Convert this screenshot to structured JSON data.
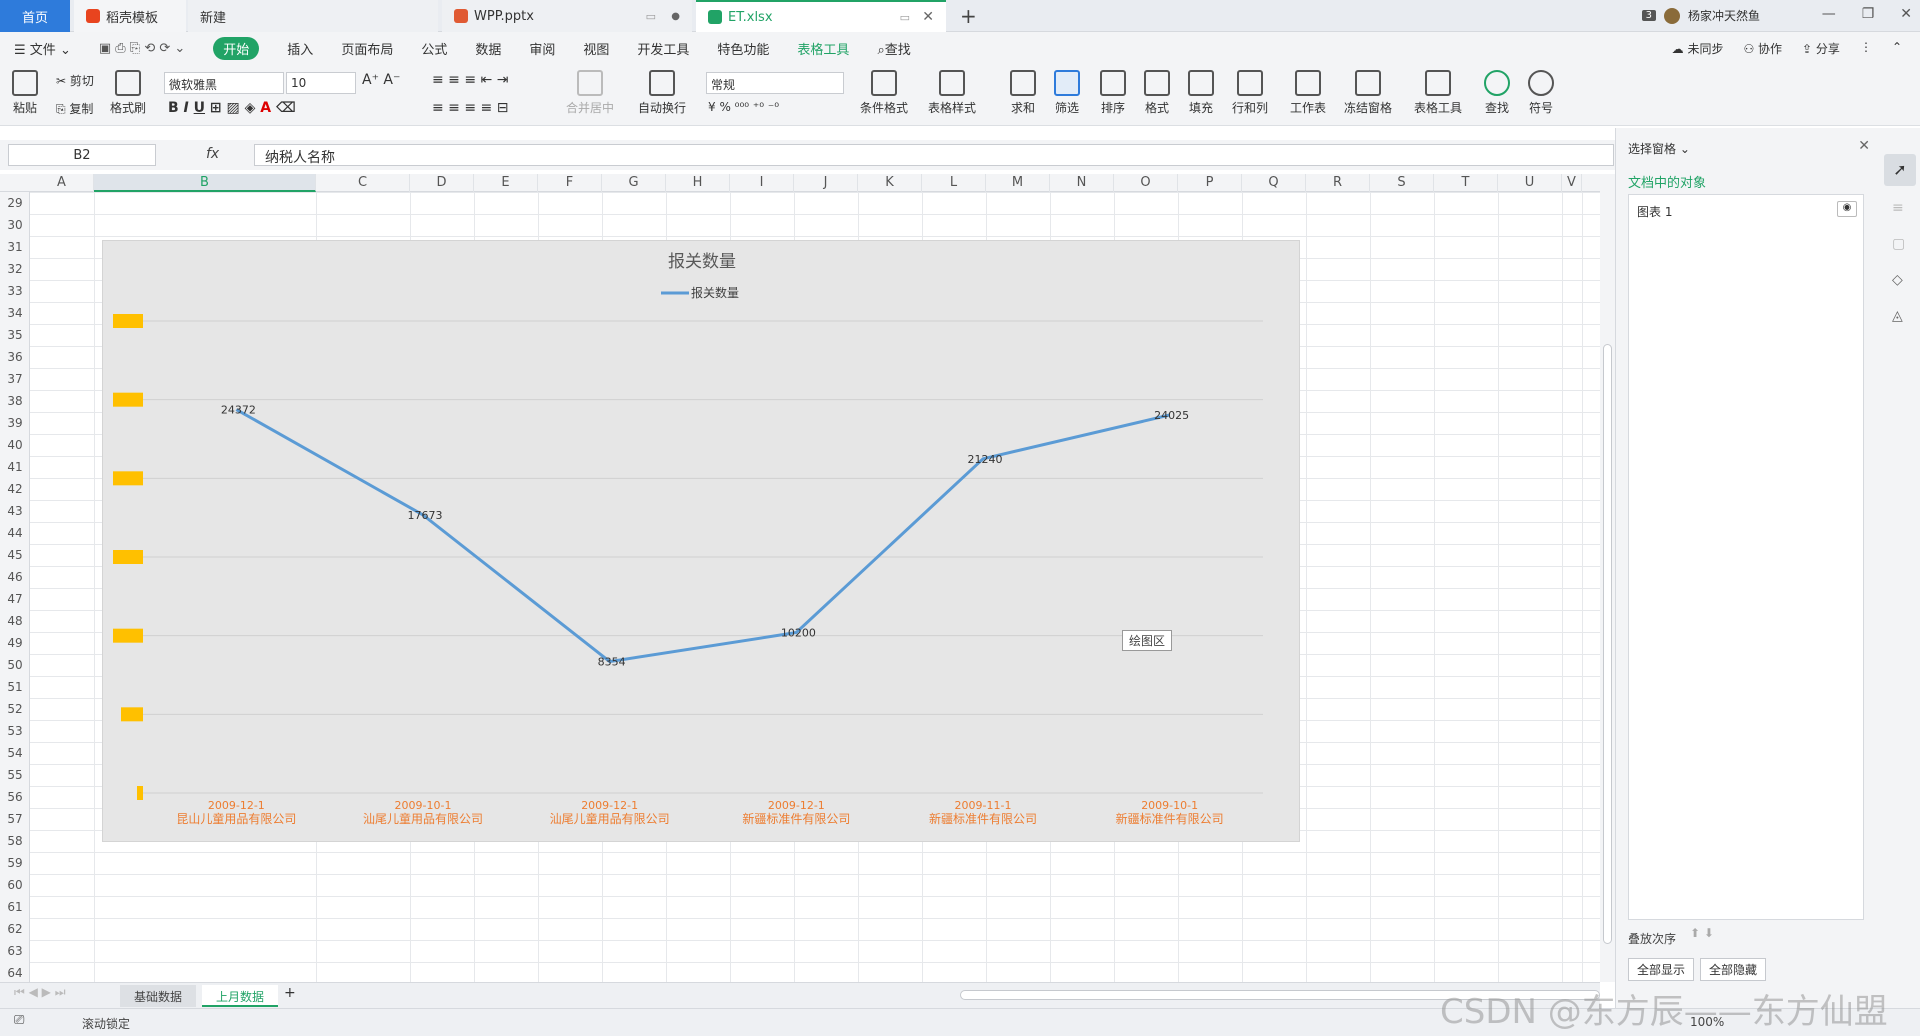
{
  "tabs": {
    "home": "首页",
    "t1": "稻壳模板",
    "t2": "新建",
    "t3": "WPP.pptx",
    "t4": "ET.xlsx"
  },
  "user": {
    "badge": "3",
    "name": "杨家冲天然鱼"
  },
  "menu": {
    "file": "文件",
    "start": "开始",
    "insert": "插入",
    "layout": "页面布局",
    "formula": "公式",
    "data": "数据",
    "review": "审阅",
    "view": "视图",
    "dev": "开发工具",
    "special": "特色功能",
    "tabletool": "表格工具",
    "search": "查找"
  },
  "menuright": {
    "sync": "未同步",
    "collab": "协作",
    "share": "分享"
  },
  "ribbon": {
    "paste": "粘贴",
    "cut": "剪切",
    "copy": "复制",
    "fmt": "格式刷",
    "font": "微软雅黑",
    "size": "10",
    "merge": "合并居中",
    "wrap": "自动换行",
    "numfmt": "常规",
    "cond": "条件格式",
    "tstyle": "表格样式",
    "sum": "求和",
    "filter": "筛选",
    "sort": "排序",
    "format": "格式",
    "fill": "填充",
    "rowcol": "行和列",
    "sheet": "工作表",
    "freeze": "冻结窗格",
    "ttool": "表格工具",
    "find": "查找",
    "symbol": "符号"
  },
  "formula": {
    "cell": "B2",
    "fx": "fx",
    "value": "纳税人名称"
  },
  "columns": [
    "A",
    "B",
    "C",
    "D",
    "E",
    "F",
    "G",
    "H",
    "I",
    "J",
    "K",
    "L",
    "M",
    "N",
    "O",
    "P",
    "Q",
    "R",
    "S",
    "T",
    "U",
    "V"
  ],
  "rows": [
    "29",
    "30",
    "31",
    "32",
    "33",
    "34",
    "35",
    "36",
    "37",
    "38",
    "39",
    "40",
    "41",
    "42",
    "43",
    "44",
    "45",
    "46",
    "47",
    "48",
    "49",
    "50",
    "51",
    "52",
    "53",
    "54",
    "55",
    "56",
    "57",
    "58",
    "59",
    "60",
    "61",
    "62",
    "63",
    "64"
  ],
  "chart_data": {
    "type": "line",
    "title": "报关数量",
    "legend": "报关数量",
    "categories": [
      [
        "2009-12-1",
        "昆山儿童用品有限公司"
      ],
      [
        "2009-10-1",
        "汕尾儿童用品有限公司"
      ],
      [
        "2009-12-1",
        "汕尾儿童用品有限公司"
      ],
      [
        "2009-12-1",
        "新疆标准件有限公司"
      ],
      [
        "2009-11-1",
        "新疆标准件有限公司"
      ],
      [
        "2009-10-1",
        "新疆标准件有限公司"
      ]
    ],
    "series": [
      {
        "name": "报关数量",
        "values": [
          24372,
          17673,
          8354,
          10200,
          21240,
          24025
        ]
      }
    ],
    "ylim": [
      0,
      30000
    ],
    "color": "#5b9bd5",
    "labelcolor": "#ed7d31",
    "plotlabel": "绘图区"
  },
  "pane": {
    "title": "选择窗格",
    "sub": "文档中的对象",
    "item": "图表 1",
    "order": "叠放次序",
    "showall": "全部显示",
    "hideall": "全部隐藏"
  },
  "sheets": {
    "s1": "基础数据",
    "s2": "上月数据"
  },
  "status": {
    "lock": "滚动锁定",
    "zoom": "100%"
  },
  "watermark": "CSDN @东方辰——东方仙盟"
}
